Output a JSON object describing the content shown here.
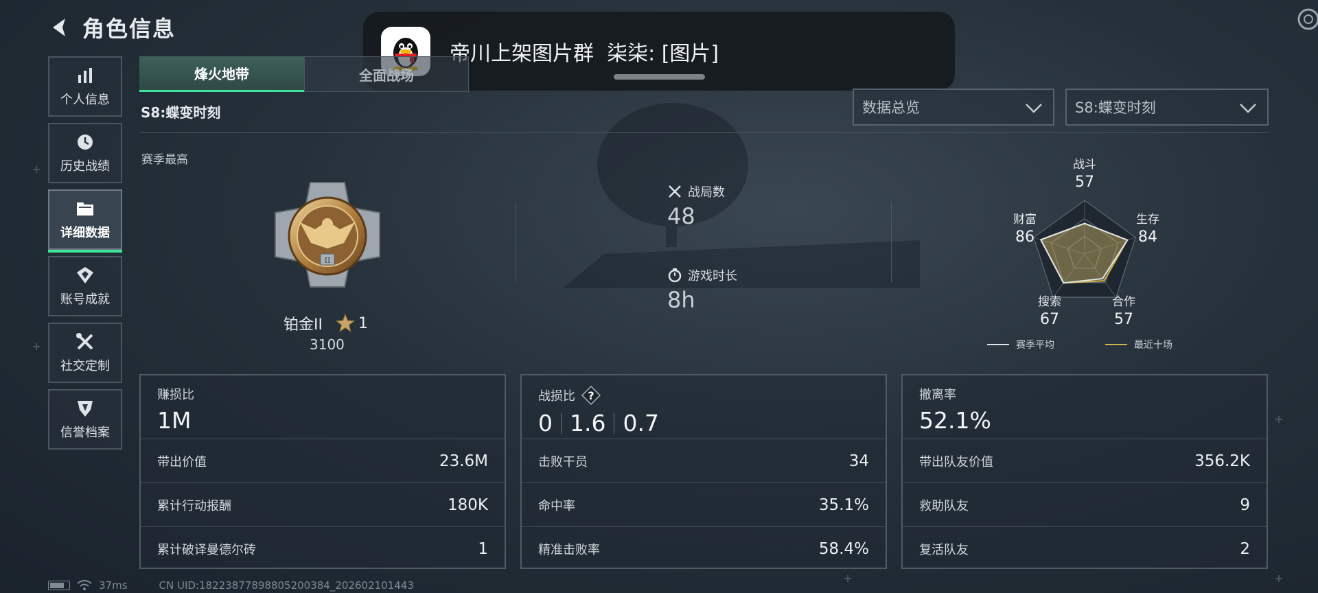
{
  "header": {
    "title": "角色信息"
  },
  "notification": {
    "group": "帝川上架图片群",
    "message": "柒柒: [图片]",
    "app_icon": "qq-penguin-icon"
  },
  "sidebar": {
    "items": [
      {
        "label": "个人信息",
        "icon": "bar-chart-icon",
        "active": false
      },
      {
        "label": "历史战绩",
        "icon": "history-clock-icon",
        "active": false
      },
      {
        "label": "详细数据",
        "icon": "folder-icon",
        "active": true
      },
      {
        "label": "账号成就",
        "icon": "achievement-icon",
        "active": false
      },
      {
        "label": "社交定制",
        "icon": "tools-icon",
        "active": false
      },
      {
        "label": "信誉档案",
        "icon": "reputation-badge-icon",
        "active": false
      }
    ]
  },
  "tabs": [
    {
      "label": "烽火地带",
      "active": true
    },
    {
      "label": "全面战场",
      "active": false
    }
  ],
  "season": {
    "title": "S8:蝶变时刻"
  },
  "filters": {
    "view": "数据总览",
    "season": "S8:蝶变时刻"
  },
  "season_best": {
    "label": "赛季最高",
    "rank_name": "铂金II",
    "stars": "1",
    "points": "3100"
  },
  "stats": {
    "matches_label": "战局数",
    "matches_value": "48",
    "playtime_label": "游戏时长",
    "playtime_value": "8h"
  },
  "radar": {
    "axes": [
      {
        "label": "战斗",
        "value": "57"
      },
      {
        "label": "生存",
        "value": "84"
      },
      {
        "label": "合作",
        "value": "57"
      },
      {
        "label": "搜索",
        "value": "67"
      },
      {
        "label": "财富",
        "value": "86"
      }
    ],
    "season_avg_values": [
      57,
      84,
      57,
      67,
      86
    ],
    "recent_values": [
      57,
      84,
      62,
      67,
      86
    ],
    "legend_avg": "赛季平均",
    "legend_recent": "最近十场",
    "color_avg": "#dfe4e8",
    "color_recent": "#d4b24a"
  },
  "panels": {
    "profit": {
      "label": "赚损比",
      "value": "1M",
      "rows": [
        {
          "k": "带出价值",
          "v": "23.6M"
        },
        {
          "k": "累计行动报酬",
          "v": "180K"
        },
        {
          "k": "累计破译曼德尔砖",
          "v": "1"
        }
      ]
    },
    "combat": {
      "label": "战损比",
      "help": "?",
      "values": [
        "0",
        "1.6",
        "0.7"
      ],
      "rows": [
        {
          "k": "击败干员",
          "v": "34"
        },
        {
          "k": "命中率",
          "v": "35.1%"
        },
        {
          "k": "精准击败率",
          "v": "58.4%"
        }
      ]
    },
    "extract": {
      "label": "撤离率",
      "value": "52.1%",
      "rows": [
        {
          "k": "带出队友价值",
          "v": "356.2K"
        },
        {
          "k": "救助队友",
          "v": "9"
        },
        {
          "k": "复活队友",
          "v": "2"
        }
      ]
    }
  },
  "footer": {
    "ping": "37ms",
    "uid": "CN UID:18223877898805200384_202602101443"
  }
}
